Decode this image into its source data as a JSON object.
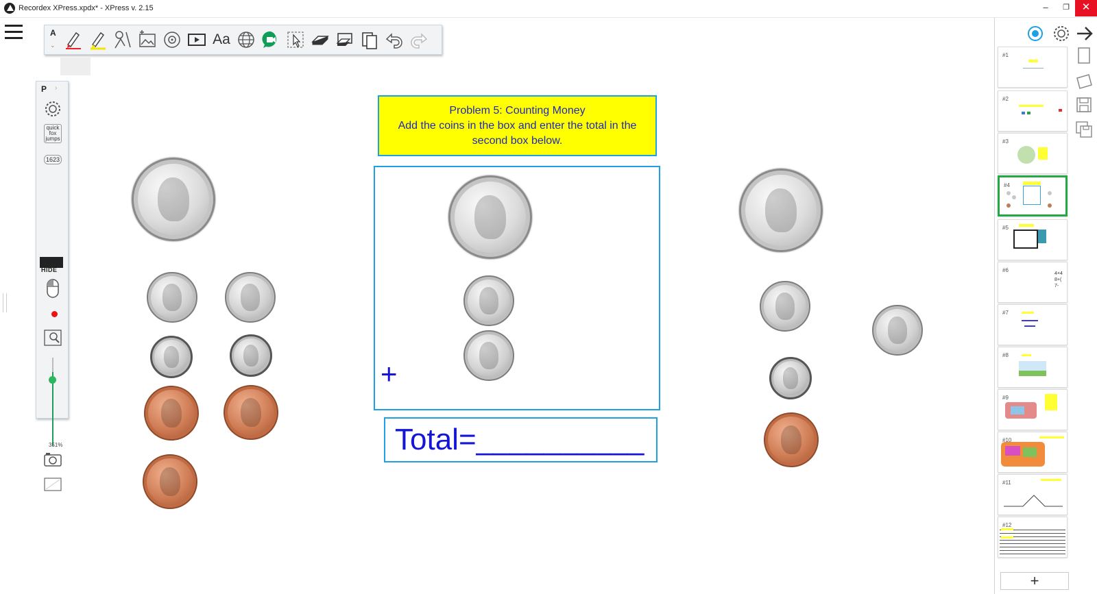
{
  "window": {
    "title": "Recordex XPress.xpdx*  -  XPress v. 2.15",
    "minimize": "–",
    "restore": "❐",
    "close": "✕"
  },
  "toolbar": {
    "mode_letter": "A",
    "caret": "⌄",
    "text_tool_label": "Aa"
  },
  "left_tools": {
    "header": "P",
    "header_arrow": "›",
    "quick_note": "quick fox jumps",
    "counter": "1623",
    "hide_label": "HIDE",
    "zoom_percent": "351%",
    "zoom_level": 0.78
  },
  "canvas": {
    "problem_title": "Problem 5: Counting Money",
    "problem_instruction_1": "Add the coins in the box and enter the total in the",
    "problem_instruction_2": "second box below.",
    "plus": "+",
    "total_text": "Total=__________"
  },
  "pages": [
    {
      "label": "#1"
    },
    {
      "label": "#2"
    },
    {
      "label": "#3"
    },
    {
      "label": "#4"
    },
    {
      "label": "#5"
    },
    {
      "label": "#6",
      "snippet": "4×4 8+( 7-"
    },
    {
      "label": "#7"
    },
    {
      "label": "#8"
    },
    {
      "label": "#9"
    },
    {
      "label": "#10"
    },
    {
      "label": "#11"
    },
    {
      "label": "#12"
    }
  ],
  "active_page": "#4",
  "add_page_label": "+",
  "colors": {
    "accent_blue": "#1ea0e6",
    "problem_bg": "#ffff00",
    "text_blue": "#1515d6",
    "active_green": "#23a843",
    "close_red": "#e81123"
  }
}
